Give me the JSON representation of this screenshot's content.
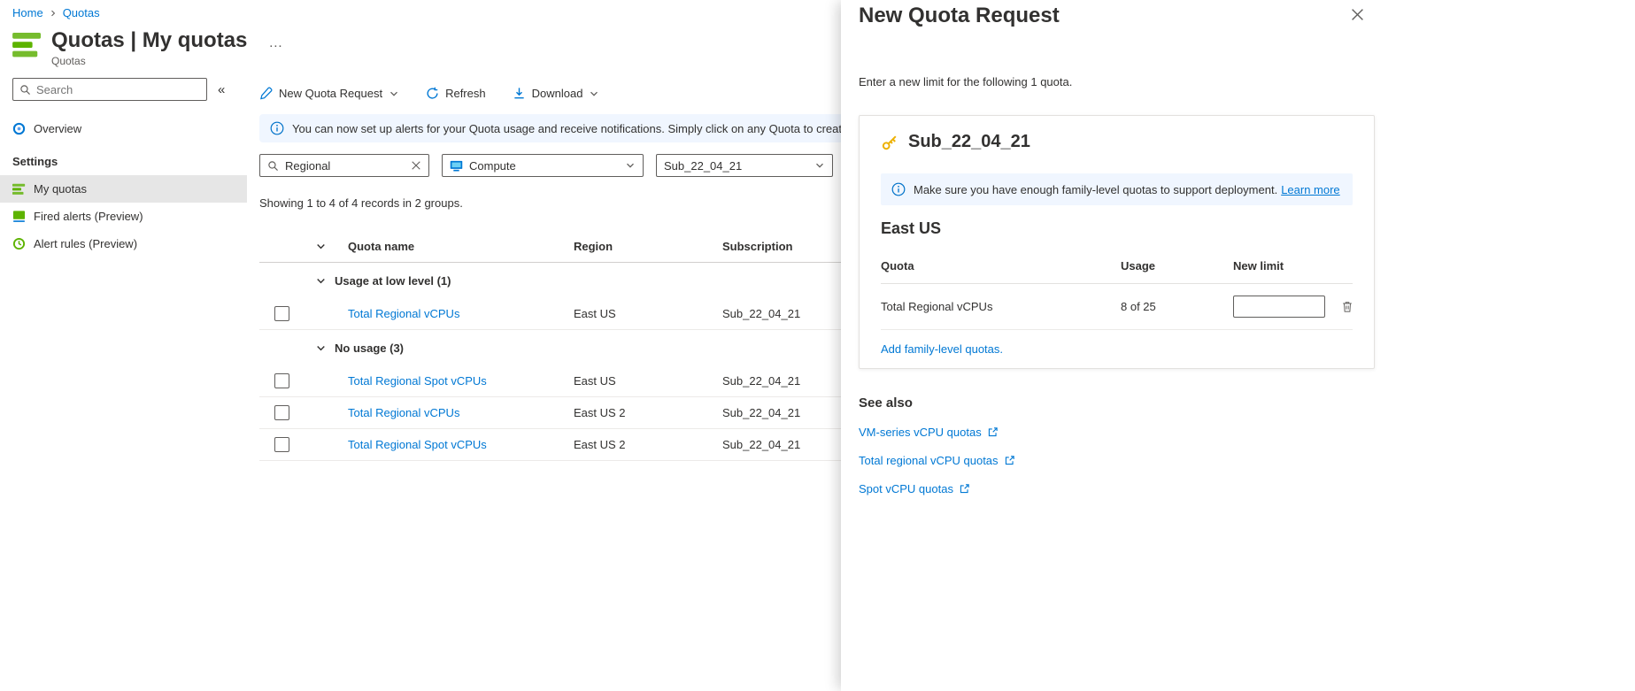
{
  "breadcrumb": {
    "items": [
      "Home",
      "Quotas"
    ]
  },
  "header": {
    "title": "Quotas | My quotas",
    "subtitle": "Quotas",
    "more": "…"
  },
  "sidebar": {
    "search_placeholder": "Search",
    "collapse": "«",
    "settings_header": "Settings",
    "items": [
      {
        "label": "Overview"
      },
      {
        "label": "My quotas"
      },
      {
        "label": "Fired alerts (Preview)"
      },
      {
        "label": "Alert rules (Preview)"
      }
    ]
  },
  "toolbar": {
    "new_quota_request": "New Quota Request",
    "refresh": "Refresh",
    "download": "Download"
  },
  "banner": {
    "text": "You can now set up alerts for your Quota usage and receive notifications. Simply click on any Quota to create a"
  },
  "filters": {
    "search_value": "Regional",
    "service": "Compute",
    "subscription": "Sub_22_04_21"
  },
  "summary": "Showing 1 to 4 of 4 records in 2 groups.",
  "table": {
    "columns": [
      "Quota name",
      "Region",
      "Subscription"
    ],
    "groups": [
      {
        "label": "Usage at low level (1)",
        "rows": [
          {
            "quota_name": "Total Regional vCPUs",
            "region": "East US",
            "subscription": "Sub_22_04_21"
          }
        ]
      },
      {
        "label": "No usage (3)",
        "rows": [
          {
            "quota_name": "Total Regional Spot vCPUs",
            "region": "East US",
            "subscription": "Sub_22_04_21"
          },
          {
            "quota_name": "Total Regional vCPUs",
            "region": "East US 2",
            "subscription": "Sub_22_04_21"
          },
          {
            "quota_name": "Total Regional Spot vCPUs",
            "region": "East US 2",
            "subscription": "Sub_22_04_21"
          }
        ]
      }
    ]
  },
  "panel": {
    "title": "New Quota Request",
    "description": "Enter a new limit for the following 1 quota.",
    "card": {
      "subscription": "Sub_22_04_21",
      "info_text": "Make sure you have enough family-level quotas to support deployment.",
      "info_link": "Learn more",
      "region": "East US",
      "columns": [
        "Quota",
        "Usage",
        "New limit"
      ],
      "row": {
        "quota": "Total Regional vCPUs",
        "usage": "8 of 25",
        "new_limit": ""
      },
      "add_link": "Add family-level quotas."
    },
    "see_also": {
      "title": "See also",
      "links": [
        "VM-series vCPU quotas",
        "Total regional vCPU quotas",
        "Spot vCPU quotas"
      ]
    }
  },
  "colors": {
    "accent": "#0078d4",
    "banner_bg": "#f0f6ff",
    "quotas_green": "#5db300",
    "key_yellow": "#edb106",
    "selected_bg": "#e6e6e6"
  }
}
